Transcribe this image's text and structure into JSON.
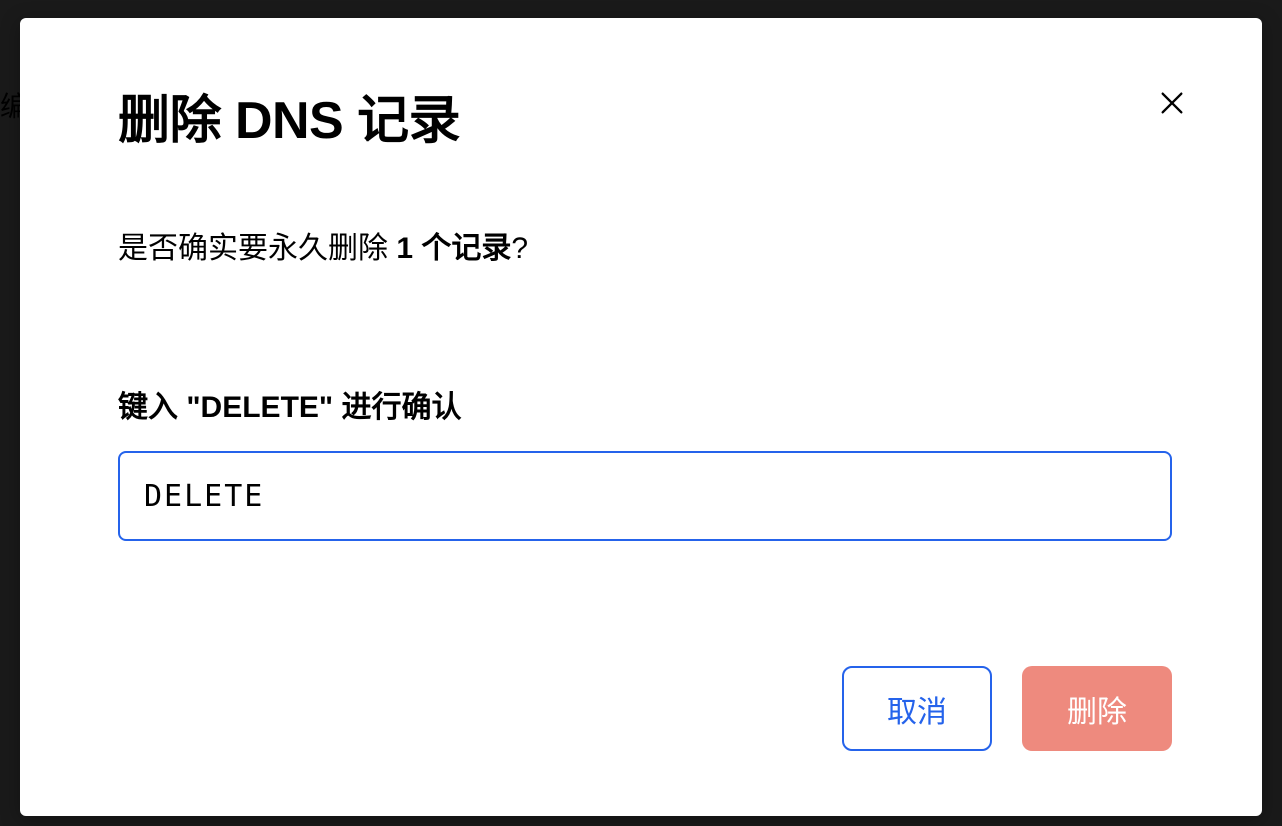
{
  "backdrop": {
    "partial_text": "编"
  },
  "modal": {
    "title": "删除 DNS 记录",
    "confirmation": {
      "prefix": "是否确实要永久删除 ",
      "count": "1 个记录",
      "suffix": "?"
    },
    "input_label": "键入 \"DELETE\" 进行确认",
    "input_value": "DELETE",
    "buttons": {
      "cancel": "取消",
      "delete": "删除"
    }
  }
}
